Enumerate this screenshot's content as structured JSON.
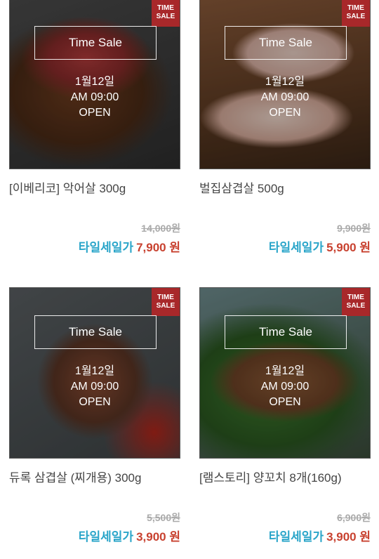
{
  "badge": {
    "line1": "TIME",
    "line2": "SALE"
  },
  "sale_box_label": "Time Sale",
  "sale_label": "타일세일가",
  "products": [
    {
      "date": "1월12일",
      "time": "AM 09:00",
      "status": "OPEN",
      "name": "[이베리코] 악어살 300g",
      "original_price": "14,000원",
      "sale_price": "7,900 원"
    },
    {
      "date": "1월12일",
      "time": "AM 09:00",
      "status": "OPEN",
      "name": "벌집삼겹살 500g",
      "original_price": "9,900원",
      "sale_price": "5,900 원"
    },
    {
      "date": "1월12일",
      "time": "AM 09:00",
      "status": "OPEN",
      "name": "듀록 삼겹살 (찌개용) 300g",
      "original_price": "5,500원",
      "sale_price": "3,900 원"
    },
    {
      "date": "1월12일",
      "time": "AM 09:00",
      "status": "OPEN",
      "name": "[램스토리] 양꼬치 8개(160g)",
      "original_price": "6,900원",
      "sale_price": "3,900 원"
    }
  ],
  "colors": {
    "badge_bg": "#a8282a",
    "sale_label": "#2aa5c9",
    "sale_price": "#c8412f",
    "original_price": "#aaaaaa"
  }
}
